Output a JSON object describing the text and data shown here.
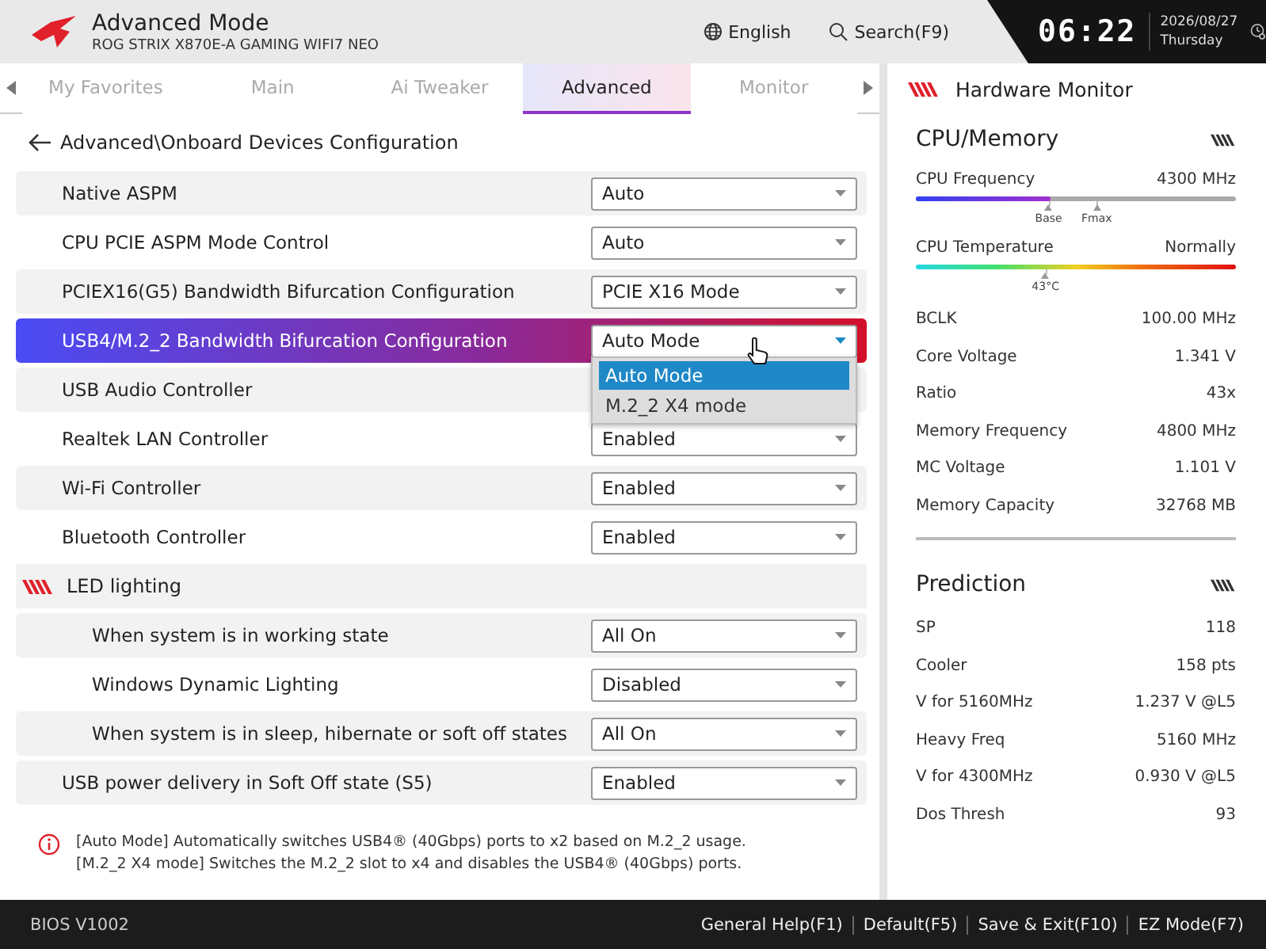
{
  "header": {
    "mode": "Advanced Mode",
    "model": "ROG STRIX X870E-A GAMING WIFI7 NEO",
    "language": "English",
    "search": "Search(F9)",
    "time": "06:22",
    "date": "2026/08/27",
    "weekday": "Thursday"
  },
  "tabs": [
    {
      "label": "My Favorites",
      "selected": false
    },
    {
      "label": "Main",
      "selected": false
    },
    {
      "label": "Ai Tweaker",
      "selected": false
    },
    {
      "label": "Advanced",
      "selected": true
    },
    {
      "label": "Monitor",
      "selected": false
    }
  ],
  "breadcrumb": "Advanced\\Onboard Devices Configuration",
  "rows": [
    {
      "kind": "setting",
      "label": "Native ASPM",
      "value": "Auto",
      "selected": false
    },
    {
      "kind": "setting",
      "label": "CPU PCIE ASPM Mode Control",
      "value": "Auto",
      "selected": false
    },
    {
      "kind": "setting",
      "label": "PCIEX16(G5) Bandwidth Bifurcation Configuration",
      "value": "PCIE X16 Mode",
      "selected": false
    },
    {
      "kind": "setting",
      "label": "USB4/M.2_2 Bandwidth Bifurcation Configuration",
      "value": "Auto Mode",
      "selected": true,
      "options": [
        {
          "label": "Auto Mode",
          "selected": true
        },
        {
          "label": "M.2_2 X4 mode",
          "selected": false
        }
      ]
    },
    {
      "kind": "setting",
      "label": "USB Audio Controller",
      "selected": false
    },
    {
      "kind": "setting",
      "label": "Realtek LAN Controller",
      "value": "Enabled",
      "selected": false
    },
    {
      "kind": "setting",
      "label": "Wi-Fi Controller",
      "value": "Enabled",
      "selected": false
    },
    {
      "kind": "setting",
      "label": "Bluetooth Controller",
      "value": "Enabled",
      "selected": false
    },
    {
      "kind": "section",
      "label": "LED lighting",
      "children": [
        {
          "kind": "setting",
          "label": "When system is in working state",
          "value": "All On",
          "selected": false
        },
        {
          "kind": "setting",
          "label": "Windows Dynamic Lighting",
          "value": "Disabled",
          "selected": false
        },
        {
          "kind": "setting",
          "label": "When system is in sleep, hibernate or soft off states",
          "value": "All On",
          "selected": false
        }
      ]
    },
    {
      "kind": "setting",
      "label": "USB power delivery in Soft Off state (S5)",
      "value": "Enabled",
      "selected": false
    }
  ],
  "help": [
    "[Auto Mode] Automatically switches USB4® (40Gbps) ports to x2 based on M.2_2 usage.",
    "[M.2_2 X4 mode] Switches the M.2_2 slot to x4 and disables the USB4® (40Gbps) ports."
  ],
  "monitor": {
    "title": "Hardware Monitor",
    "sections": [
      {
        "title": "CPU/Memory",
        "gauges": [
          {
            "kind": "frequency",
            "label": "CPU Frequency",
            "reading": "4300 MHz",
            "level": 0.42,
            "markers": [
              {
                "label": "Base",
                "level": 0.42
              },
              {
                "label": "Fmax",
                "level": 0.57
              }
            ]
          },
          {
            "kind": "temperature",
            "label": "CPU Temperature",
            "reading": "Normally",
            "markers": [
              {
                "label": "43°C",
                "level": 0.41
              }
            ]
          }
        ],
        "items": [
          {
            "label": "BCLK",
            "value": "100.00 MHz"
          },
          {
            "label": "Core Voltage",
            "value": "1.341 V"
          },
          {
            "label": "Ratio",
            "value": "43x"
          },
          {
            "label": "Memory Frequency",
            "value": "4800 MHz"
          },
          {
            "label": "MC Voltage",
            "value": "1.101 V"
          },
          {
            "label": "Memory Capacity",
            "value": "32768 MB"
          }
        ]
      },
      {
        "title": "Prediction",
        "items": [
          {
            "label": "SP",
            "value": "118"
          },
          {
            "label": "Cooler",
            "value": "158 pts"
          },
          {
            "label": "V for 5160MHz",
            "value": "1.237 V @L5"
          },
          {
            "label": "Heavy Freq",
            "value": "5160 MHz"
          },
          {
            "label": "V for 4300MHz",
            "value": "0.930 V @L5"
          },
          {
            "label": "Dos Thresh",
            "value": "93"
          }
        ]
      }
    ]
  },
  "footer": {
    "version": "BIOS V1002",
    "actions": [
      "General Help(F1)",
      "Default(F5)",
      "Save & Exit(F10)",
      "EZ Mode(F7)"
    ]
  }
}
